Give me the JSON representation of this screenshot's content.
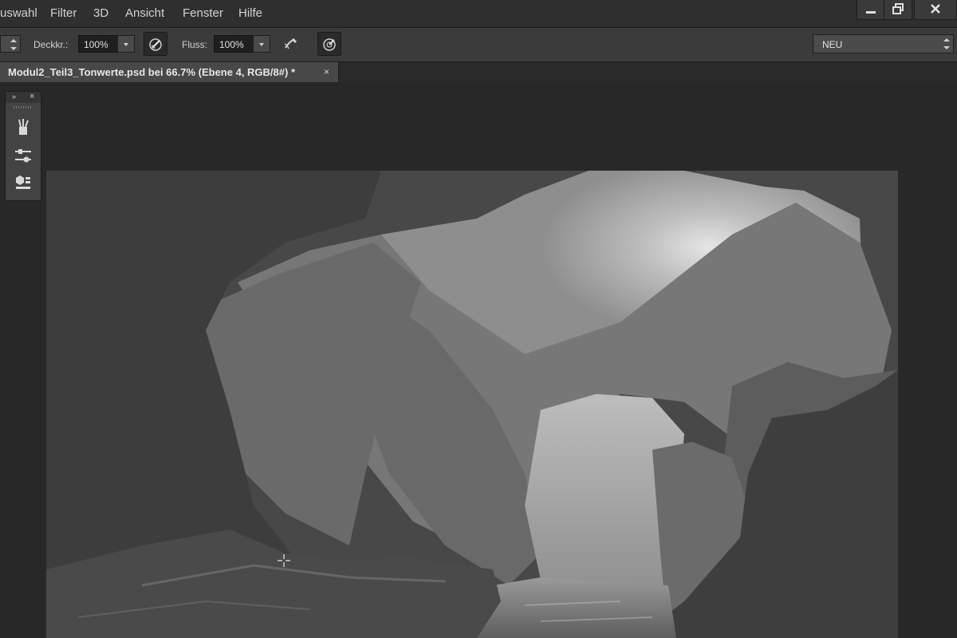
{
  "menu": {
    "items": [
      "uswahl",
      "Filter",
      "3D",
      "Ansicht",
      "Fenster",
      "Hilfe"
    ]
  },
  "window_controls": {
    "icons": [
      "minimize-icon",
      "restore-icon",
      "close-icon"
    ]
  },
  "options_bar": {
    "opacity_label": "Deckkr.:",
    "opacity_value": "100%",
    "flow_label": "Fluss:",
    "flow_value": "100%",
    "preset_value": "NEU"
  },
  "document": {
    "tab_title": "Modul2_Teil3_Tonwerte.psd bei 66.7% (Ebene 4, RGB/8#) *",
    "tab_close": "×"
  },
  "panel": {
    "collapse": "»",
    "close": "×",
    "icons": [
      "brush-presets-icon",
      "adjustments-icon",
      "3d-cube-icon"
    ]
  },
  "colors": {
    "ui_dark": "#282828",
    "menubar": "#2f2f2f",
    "optbar": "#3b3b3b",
    "tab_active": "#484848"
  }
}
